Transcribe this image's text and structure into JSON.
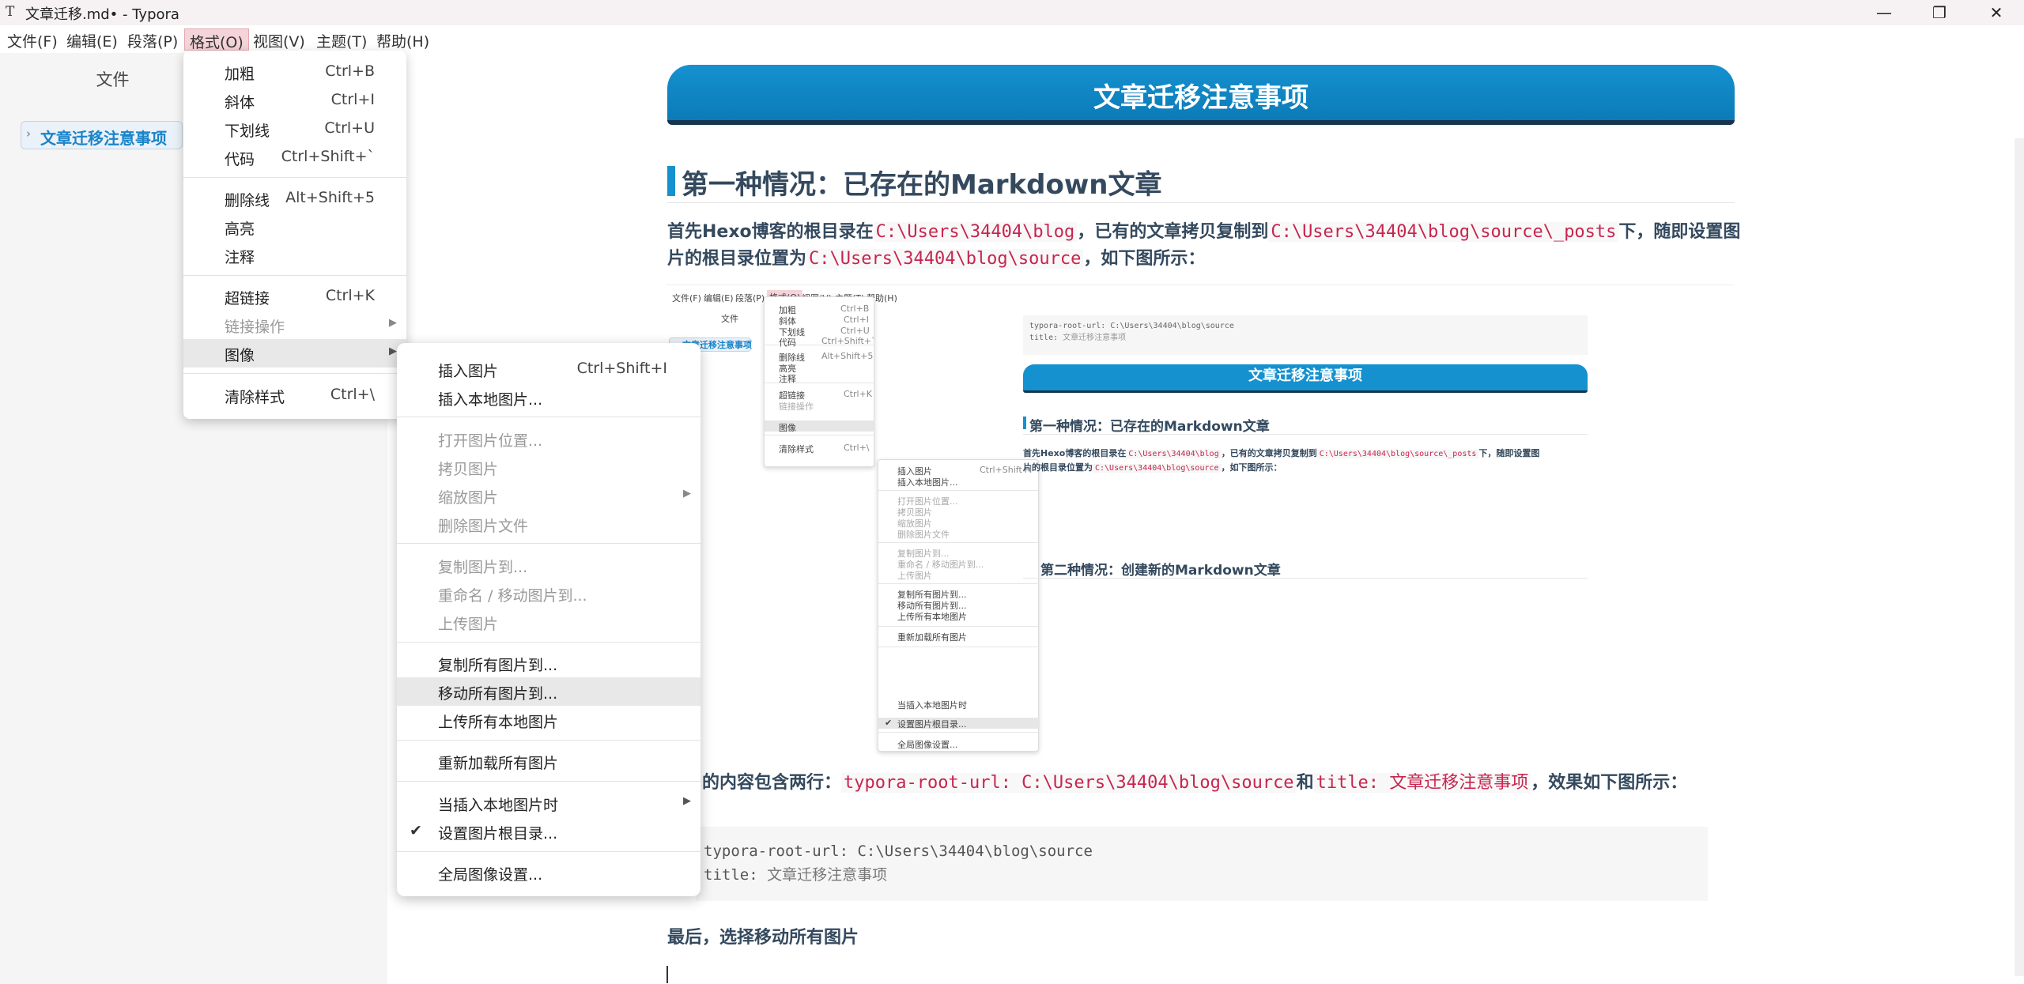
{
  "window": {
    "icon": "T",
    "title": "文章迁移.md• - Typora",
    "minimize": "—",
    "maximize": "❐",
    "close": "✕"
  },
  "menubar": [
    "文件(F)",
    "编辑(E)",
    "段落(P)",
    "格式(O)",
    "视图(V)",
    "主题(T)",
    "帮助(H)"
  ],
  "sidebar": {
    "title": "文件",
    "file": "文章迁移注意事项"
  },
  "format_menu": {
    "items": [
      {
        "label": "加粗",
        "key": "Ctrl+B"
      },
      {
        "label": "斜体",
        "key": "Ctrl+I"
      },
      {
        "label": "下划线",
        "key": "Ctrl+U"
      },
      {
        "label": "代码",
        "key": "Ctrl+Shift+`"
      },
      {
        "label": "删除线",
        "key": "Alt+Shift+5"
      },
      {
        "label": "高亮",
        "key": ""
      },
      {
        "label": "注释",
        "key": ""
      },
      {
        "label": "超链接",
        "key": "Ctrl+K"
      },
      {
        "label": "链接操作",
        "key": ""
      },
      {
        "label": "图像",
        "key": ""
      },
      {
        "label": "清除样式",
        "key": "Ctrl+\\"
      }
    ]
  },
  "image_menu": {
    "items": [
      {
        "label": "插入图片",
        "key": "Ctrl+Shift+I"
      },
      {
        "label": "插入本地图片...",
        "key": ""
      },
      {
        "label": "打开图片位置...",
        "key": ""
      },
      {
        "label": "拷贝图片",
        "key": ""
      },
      {
        "label": "缩放图片",
        "key": ""
      },
      {
        "label": "删除图片文件",
        "key": ""
      },
      {
        "label": "复制图片到...",
        "key": ""
      },
      {
        "label": "重命名 / 移动图片到...",
        "key": ""
      },
      {
        "label": "上传图片",
        "key": ""
      },
      {
        "label": "复制所有图片到...",
        "key": ""
      },
      {
        "label": "移动所有图片到...",
        "key": ""
      },
      {
        "label": "上传所有本地图片",
        "key": ""
      },
      {
        "label": "重新加载所有图片",
        "key": ""
      },
      {
        "label": "当插入本地图片时",
        "key": ""
      },
      {
        "label": "设置图片根目录...",
        "key": ""
      },
      {
        "label": "全局图像设置...",
        "key": ""
      }
    ],
    "check": "✔"
  },
  "document": {
    "banner": "文章迁移注意事项",
    "h2_1": "第一种情况：已存在的Markdown文章",
    "p1": {
      "t1": "首先Hexo博客的根目录在",
      "c1": "C:\\Users\\34404\\blog",
      "t2": "，已有的文章拷贝复制到",
      "c2": "C:\\Users\\34404\\blog\\source\\_posts",
      "t3": "下，随即设置图",
      "t4": "片的根目录位置为",
      "c3": "C:\\Users\\34404\\blog\\source",
      "t5": "，如下图所示："
    },
    "p2": {
      "t1": "的内容包含两行：",
      "c1": "typora-root-url: C:\\Users\\34404\\blog\\source",
      "t2": "和",
      "c2": "title: 文章迁移注意事项",
      "t3": "，效果如下图所示："
    },
    "code": {
      "l1k": "typora-root-url:",
      "l1v": "C:\\Users\\34404\\blog\\source",
      "l2k": "title:",
      "l2v": "文章迁移注意事项"
    },
    "p3": "最后，选择移动所有图片"
  },
  "screenshot": {
    "menubar": [
      "文件(F)",
      "编辑(E)",
      "段落(P)",
      "格式(O)",
      "视图(V)",
      "主题(T)",
      "帮助(H)"
    ],
    "sidebar_title": "文件",
    "file": "文章迁移注意事项",
    "format_items": [
      {
        "label": "加粗",
        "key": "Ctrl+B"
      },
      {
        "label": "斜体",
        "key": "Ctrl+I"
      },
      {
        "label": "下划线",
        "key": "Ctrl+U"
      },
      {
        "label": "代码",
        "key": "Ctrl+Shift+`"
      },
      {
        "label": "删除线",
        "key": "Alt+Shift+5"
      },
      {
        "label": "高亮",
        "key": ""
      },
      {
        "label": "注释",
        "key": ""
      },
      {
        "label": "超链接",
        "key": "Ctrl+K"
      },
      {
        "label": "链接操作",
        "key": ""
      },
      {
        "label": "图像",
        "key": ""
      },
      {
        "label": "清除样式",
        "key": "Ctrl+\\"
      }
    ],
    "image_items": [
      {
        "label": "插入图片",
        "key": "Ctrl+Shift+I"
      },
      {
        "label": "插入本地图片...",
        "key": ""
      },
      {
        "label": "打开图片位置...",
        "key": ""
      },
      {
        "label": "拷贝图片",
        "key": ""
      },
      {
        "label": "缩放图片",
        "key": ""
      },
      {
        "label": "删除图片文件",
        "key": ""
      },
      {
        "label": "复制图片到...",
        "key": ""
      },
      {
        "label": "重命名 / 移动图片到...",
        "key": ""
      },
      {
        "label": "上传图片",
        "key": ""
      },
      {
        "label": "复制所有图片到...",
        "key": ""
      },
      {
        "label": "移动所有图片到...",
        "key": ""
      },
      {
        "label": "上传所有本地图片",
        "key": ""
      },
      {
        "label": "重新加载所有图片",
        "key": ""
      },
      {
        "label": "当插入本地图片时",
        "key": ""
      },
      {
        "label": "设置图片根目录...",
        "key": ""
      },
      {
        "label": "全局图像设置...",
        "key": ""
      }
    ],
    "code_l1": "typora-root-url: C:\\Users\\34404\\blog\\source",
    "code_l2k": "title:",
    "code_l2v": "文章迁移注意事项",
    "banner": "文章迁移注意事项",
    "h2_1": "第一种情况：已存在的Markdown文章",
    "p1a": "首先Hexo博客的根目录在",
    "p1c1": "C:\\Users\\34404\\blog",
    "p1b": "，已有的文章拷贝复制到",
    "p1c2": "C:\\Users\\34404\\blog\\source\\_posts",
    "p1t": "下，随即设置图",
    "p1d": "片的根目录位置为",
    "p1c3": "C:\\Users\\34404\\blog\\source",
    "p1e": "，如下图所示：",
    "h2_2": "第二种情况：创建新的Markdown文章"
  }
}
